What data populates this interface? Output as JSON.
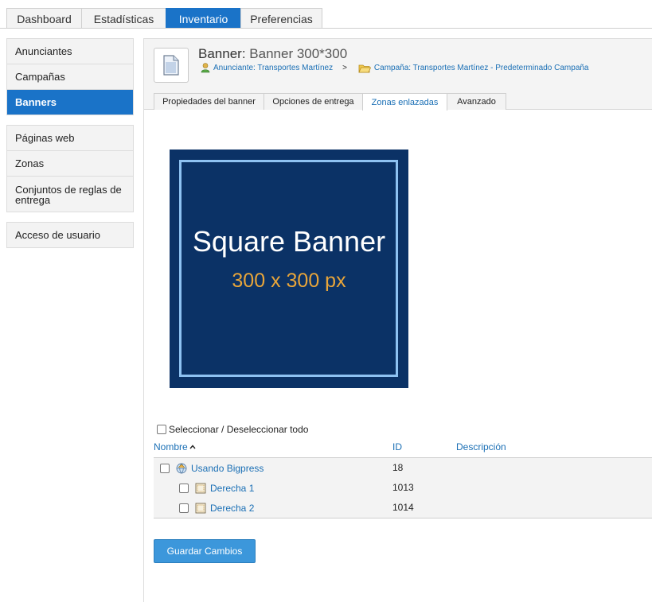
{
  "top_tabs": [
    {
      "label": "Dashboard"
    },
    {
      "label": "Estadísticas"
    },
    {
      "label": "Inventario",
      "active": true
    },
    {
      "label": "Preferencias"
    }
  ],
  "sidebar": {
    "group1": [
      {
        "label": "Anunciantes"
      },
      {
        "label": "Campañas"
      },
      {
        "label": "Banners",
        "active": true
      }
    ],
    "group2": [
      {
        "label": "Páginas web"
      },
      {
        "label": "Zonas"
      },
      {
        "label": "Conjuntos de reglas de entrega"
      }
    ],
    "group3": [
      {
        "label": "Acceso de usuario"
      }
    ]
  },
  "header": {
    "title_prefix": "Banner:",
    "title_name": "Banner 300*300",
    "advertiser": "Anunciante: Transportes Martínez",
    "separator": ">",
    "campaign": "Campaña: Transportes Martínez - Predeterminado Campaña"
  },
  "sub_tabs": [
    {
      "label": "Propiedades del banner"
    },
    {
      "label": "Opciones de entrega"
    },
    {
      "label": "Zonas enlazadas",
      "active": true
    },
    {
      "label": "Avanzado"
    }
  ],
  "banner": {
    "line1": "Square Banner",
    "line2": "300 x 300 px",
    "bg_color": "#0b3266",
    "accent_color": "#e8a53a"
  },
  "table": {
    "select_all": "Seleccionar / Deseleccionar todo",
    "col_name": "Nombre",
    "col_id": "ID",
    "col_desc": "Descripción",
    "rows": [
      {
        "name": "Usando Bigpress",
        "id": "18",
        "icon": "website-icon"
      },
      {
        "name": "Derecha 1",
        "id": "1013",
        "icon": "zone-icon"
      },
      {
        "name": "Derecha 2",
        "id": "1014",
        "icon": "zone-icon"
      }
    ]
  },
  "save_label": "Guardar Cambios",
  "colors": {
    "accent": "#1a73c8",
    "link": "#1a6fb5",
    "button": "#3c97db"
  }
}
